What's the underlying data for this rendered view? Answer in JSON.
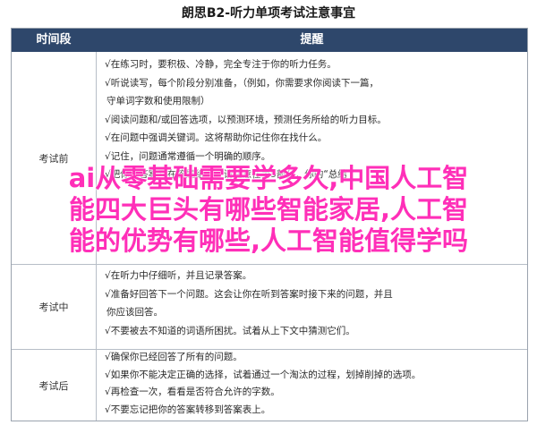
{
  "title": "朗思B2-听力单项考试注意事宜",
  "header": {
    "col_period": "时间段",
    "col_tips": "提醒"
  },
  "sections": [
    {
      "label": "考试前",
      "items": [
        "√在练习时，要积极、冷静，完全专注于你的听力任务。",
        "√听说读写，每个阶段分别准备，（例如，你需要求你阅读下一篇，",
        "守单词字数和使用限制）",
        "√阅读问题和/或回答选项，以预测环境，预测任务所给的听力目标。",
        "√在问题中强调关键词。这将帮助你记住你在找什么。",
        "√记住，问题通常遵循一个明确的顺序。",
        "√把你的答案写在答题纸上。请注意在第5部分，你的“总结"
      ]
    },
    {
      "label": "考试中",
      "items": [
        "√在听力中仔细听，并且记录答案。",
        "√准备好回答下一个问题。这会让你在听到答案时接下来的问题，并且",
        "你应该回答。",
        "√不要被去不知道的词语所困扰。试着从上下文中猜测它们。"
      ]
    },
    {
      "label": "考试后",
      "items": [
        "√确保你已经回答了所有的问题。",
        "√如果你不能决定正确的选择，试着通过一个淘汰的过程，划掉削掉的选项。",
        "√再检查一次，看看是否符合允许的字数。",
        "√不要忘记把你的答案转移到答案表上。"
      ]
    }
  ],
  "overlay_text": {
    "line1": "ai从零基础需要学多久,中国人工智",
    "line2": "能四大巨头有哪些智能家居,人工智",
    "line3": "能的优势有哪些,人工智能值得学吗"
  }
}
